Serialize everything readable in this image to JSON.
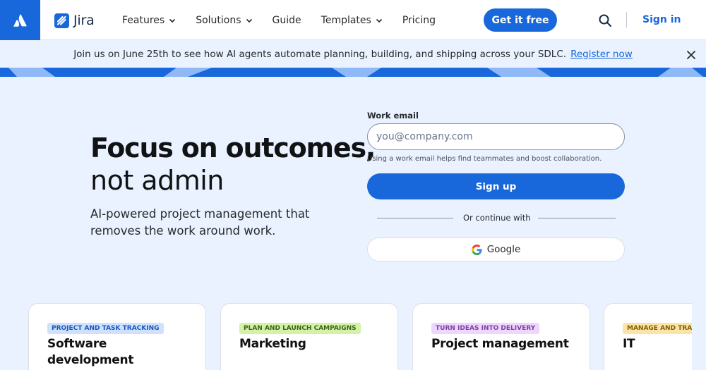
{
  "nav": {
    "brand": "Jira",
    "items": [
      {
        "label": "Features",
        "has_menu": true
      },
      {
        "label": "Solutions",
        "has_menu": true
      },
      {
        "label": "Guide",
        "has_menu": false
      },
      {
        "label": "Templates",
        "has_menu": true
      },
      {
        "label": "Pricing",
        "has_menu": false
      }
    ],
    "cta_label": "Get it free",
    "signin_label": "Sign in",
    "search_icon": "search-icon"
  },
  "banner": {
    "text": "Join us on June 25th to see how AI agents automate planning, building, and shipping across your SDLC.",
    "link_label": "Register now"
  },
  "hero": {
    "title_bold": "Focus on outcomes,",
    "title_regular": "not admin",
    "subtitle": "AI-powered project management that removes the work around work."
  },
  "form": {
    "label": "Work email",
    "placeholder": "you@company.com",
    "value": "",
    "helper": "Using a work email helps find teammates and boost collaboration.",
    "signup_label": "Sign up",
    "divider_text": "Or continue with",
    "google_label": "Google"
  },
  "cards": [
    {
      "tag": "PROJECT AND TASK TRACKING",
      "title": "Software development"
    },
    {
      "tag": "PLAN AND LAUNCH CAMPAIGNS",
      "title": "Marketing"
    },
    {
      "tag": "TURN IDEAS INTO DELIVERY",
      "title": "Project management"
    },
    {
      "tag": "MANAGE AND TRACK",
      "title": "IT"
    }
  ],
  "colors": {
    "brand_blue": "#1868db",
    "page_bg": "#e9f2fe",
    "tag_blue_bg": "#cfe1fd",
    "tag_green_bg": "#d3f1a7",
    "tag_purple_bg": "#eed7fc",
    "tag_orange_bg": "#fce4a6"
  }
}
